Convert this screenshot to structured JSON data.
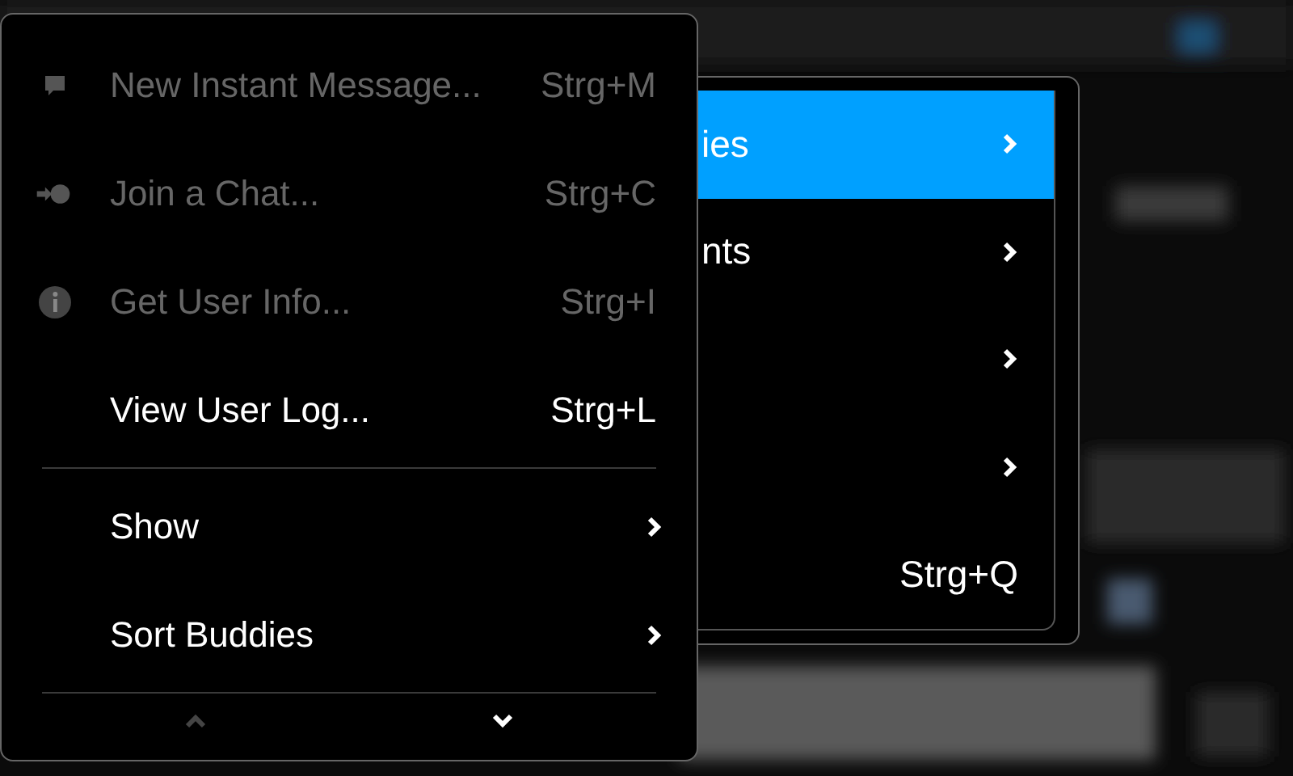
{
  "back_menu": {
    "items": [
      {
        "kind": "submenu",
        "label": "ies",
        "selected": true
      },
      {
        "kind": "submenu",
        "label": "nts",
        "selected": false
      },
      {
        "kind": "submenu",
        "selected": false
      },
      {
        "kind": "submenu",
        "selected": false
      },
      {
        "kind": "action",
        "shortcut": "Strg+Q",
        "selected": false
      }
    ]
  },
  "menu": {
    "items": [
      {
        "kind": "action",
        "label": "New Instant Message...",
        "shortcut": "Strg+M",
        "disabled": true
      },
      {
        "kind": "action",
        "label": "Join a Chat...",
        "shortcut": "Strg+C",
        "disabled": true
      },
      {
        "kind": "action",
        "label": "Get User Info...",
        "shortcut": "Strg+I",
        "disabled": true
      },
      {
        "kind": "action",
        "label": "View User Log...",
        "shortcut": "Strg+L",
        "disabled": false
      },
      {
        "kind": "separator"
      },
      {
        "kind": "submenu",
        "label": "Show",
        "disabled": false
      },
      {
        "kind": "submenu",
        "label": "Sort Buddies",
        "disabled": false
      },
      {
        "kind": "separator"
      }
    ],
    "scroll_up": {
      "disabled": true
    },
    "scroll_down": {
      "disabled": false
    }
  }
}
